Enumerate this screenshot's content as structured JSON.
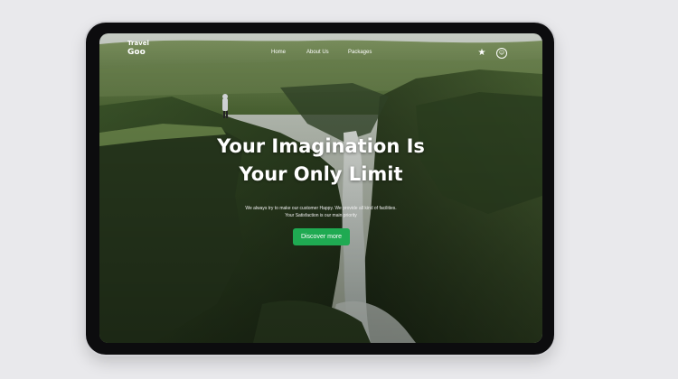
{
  "brand": {
    "line1": "Travel",
    "line2": "Goo"
  },
  "nav": {
    "items": [
      "Home",
      "About Us",
      "Packages"
    ]
  },
  "header_icons": {
    "favorite": "star-icon",
    "profile": "user-circle-icon"
  },
  "hero": {
    "title_line1": "Your Imagination Is",
    "title_line2": "Your Only Limit",
    "subtitle_line1": "We always try to make our customer Happy. We provide all kind of facilities.",
    "subtitle_line2": "Your Satisfaction is our main priority",
    "cta_label": "Discover more"
  },
  "colors": {
    "cta": "#1faa52",
    "device_frame": "#0c0c0e",
    "backdrop": "#e9e9ec"
  }
}
